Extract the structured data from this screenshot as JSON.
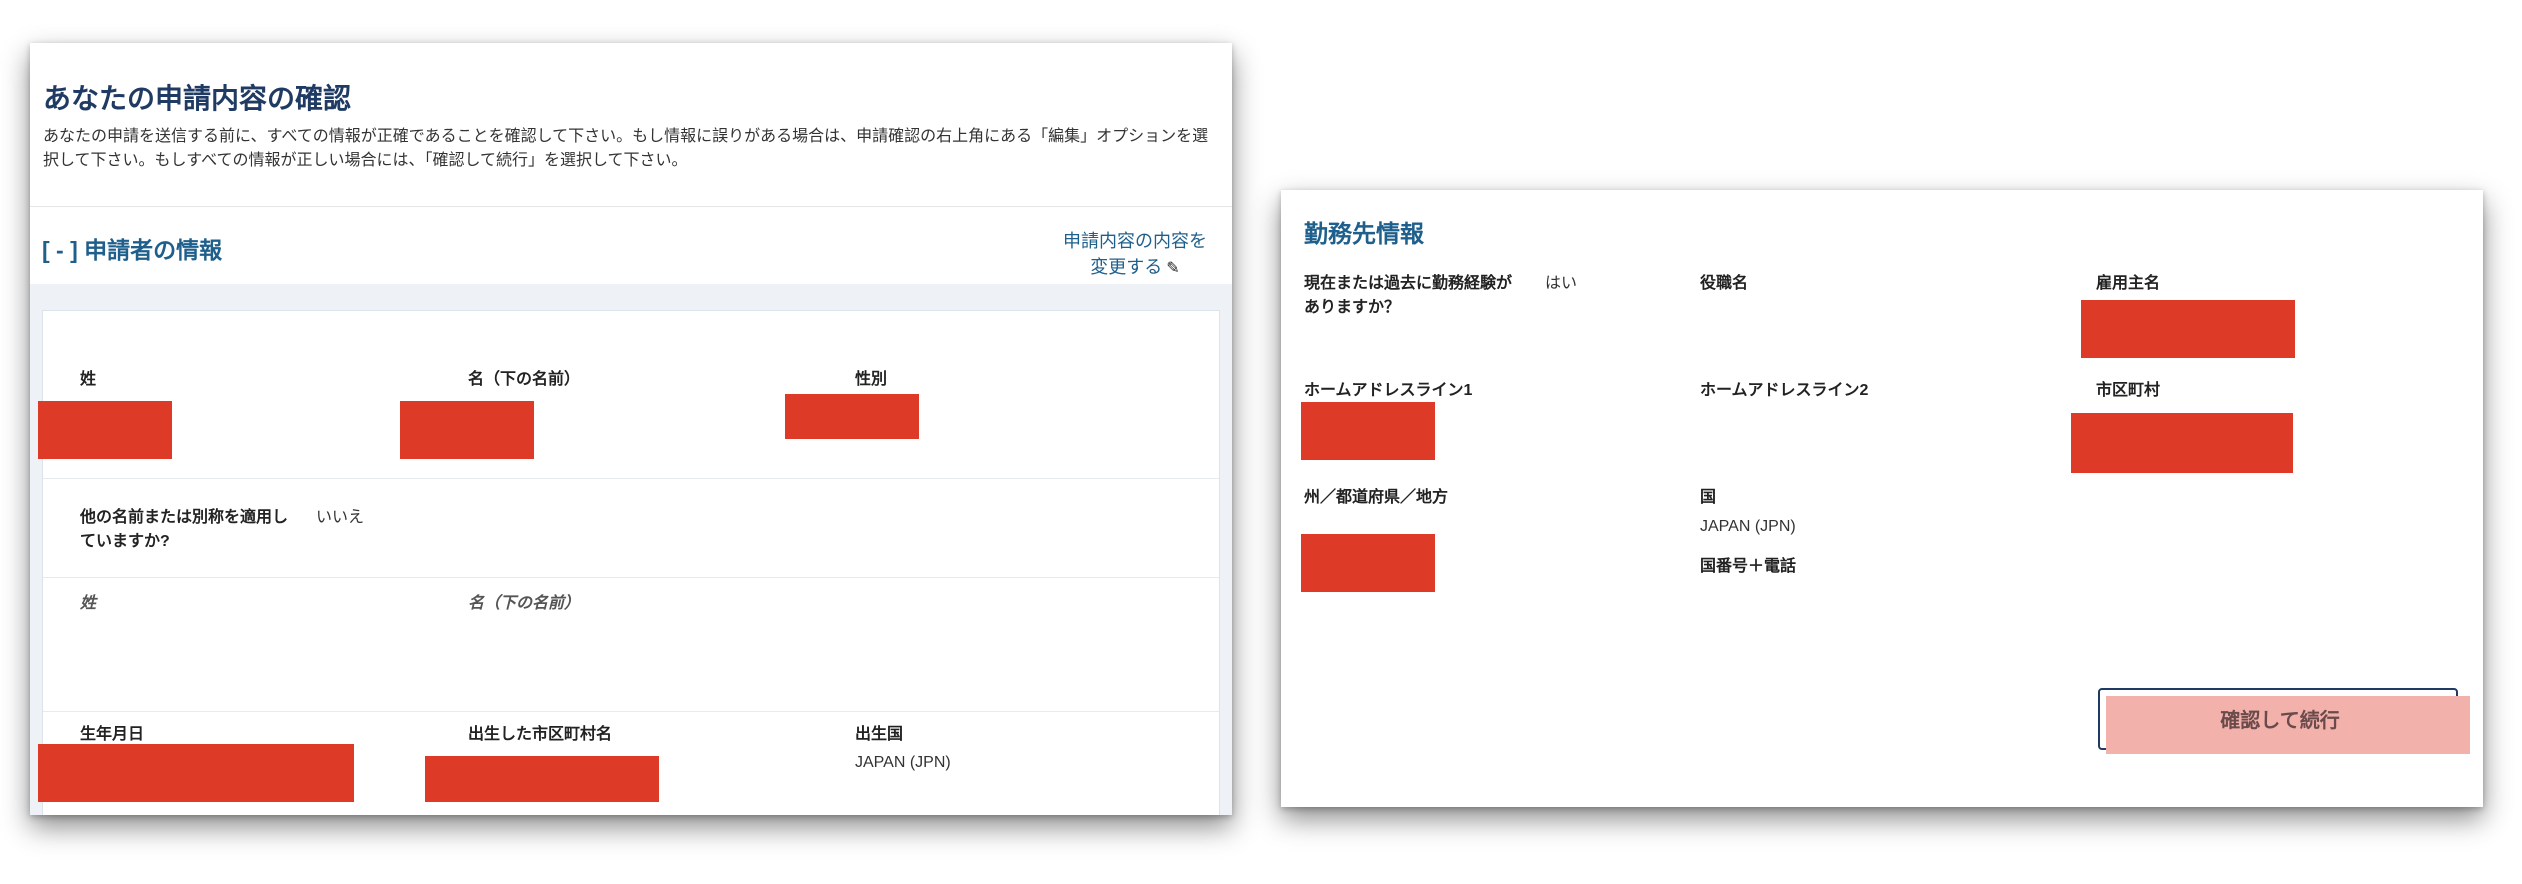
{
  "review": {
    "title": "あなたの申請内容の確認",
    "description": "あなたの申請を送信する前に、すべての情報が正確であることを確認して下さい。もし情報に誤りがある場合は、申請確認の右上角にある「編集」オプションを選択して下さい。もしすべての情報が正しい場合には、「確認して続行」を選択して下さい。"
  },
  "applicant": {
    "section_title": "[ - ] 申請者の情報",
    "edit_line1": "申請内容の内容を",
    "edit_line2": "変更する",
    "edit_icon": "pencil-icon",
    "surname_label": "姓",
    "given_name_label": "名（下の名前）",
    "gender_label": "性別",
    "other_names_question": "他の名前または別称を適用していますか?",
    "other_names_answer": "いいえ",
    "alias_surname_label": "姓",
    "alias_given_name_label": "名（下の名前）",
    "birth_date_label": "生年月日",
    "birth_city_label": "出生した市区町村名",
    "birth_country_label": "出生国",
    "birth_country_value": "JAPAN (JPN)"
  },
  "employment": {
    "section_title": "勤務先情報",
    "has_experience_question": "現在または過去に勤務経験がありますか？",
    "has_experience_answer": "はい",
    "job_title_label": "役職名",
    "employer_label": "雇用主名",
    "address1_label": "ホームアドレスライン1",
    "address2_label": "ホームアドレスライン2",
    "city_label": "市区町村",
    "state_label": "州／都道府県／地方",
    "country_label": "国",
    "country_value": "JAPAN (JPN)",
    "phone_label": "国番号＋電話",
    "confirm_button": "確認して続行"
  },
  "colors": {
    "heading": "#1f3a63",
    "link": "#1f5f8b",
    "redaction": "#dd3b27",
    "button_fill": "#f2b1ab"
  }
}
